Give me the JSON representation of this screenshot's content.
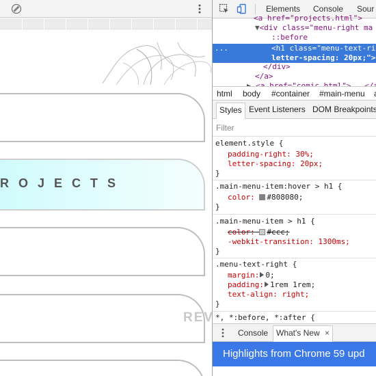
{
  "page": {
    "projects_label": "ROJECTS",
    "review_label": "REV"
  },
  "devtools": {
    "tabs": [
      "Elements",
      "Console",
      "Sour"
    ],
    "dom_lines": {
      "l0": "<a href=\"projects.html\">",
      "l1_open": "<div class=\"menu-right ma",
      "l2": "::before",
      "l3a": "<h1 class=\"menu-text-ri",
      "l3b": "letter-spacing: 20px;\">",
      "l4": "</div>",
      "l5": "</a>",
      "l6": "<a href=\"comic.html\">...</a>",
      "ellipsis": "..."
    },
    "breadcrumbs": [
      "html",
      "body",
      "#container",
      "#main-menu",
      "a"
    ],
    "styles_tabs": [
      "Styles",
      "Event Listeners",
      "DOM Breakpoints"
    ],
    "filter_placeholder": "Filter",
    "rules": {
      "r1_sel": "element.style {",
      "r1_p1": "padding-right: 30%;",
      "r1_p2": "letter-spacing: 20px;",
      "r2_sel": ".main-menu-item:hover > h1 {",
      "r2_prop": "color:",
      "r2_val": "#808080;",
      "r3_sel": ".main-menu-item > h1 {",
      "r3_prop": "color:",
      "r3_val": "#ccc;",
      "r3_p2": "-webkit-transition: 1300ms;",
      "r4_sel": ".menu-text-right {",
      "r4_p1_prop": "margin:",
      "r4_p1_val": "0;",
      "r4_p2_prop": "padding:",
      "r4_p2_val": "1rem 1rem;",
      "r4_p3": "text-align: right;",
      "r5_sel": "*, *:before, *:after {",
      "close": "}"
    },
    "drawer_tabs": [
      "Console",
      "What's New"
    ],
    "drawer_close": "×",
    "banner": "Highlights from Chrome 59 upd"
  },
  "colors": {
    "swatch_hover": "#808080",
    "swatch_item": "#cccccc",
    "selection": "#3879d9",
    "banner": "#3b78e7",
    "active_menu_start": "#cdfbfd"
  }
}
